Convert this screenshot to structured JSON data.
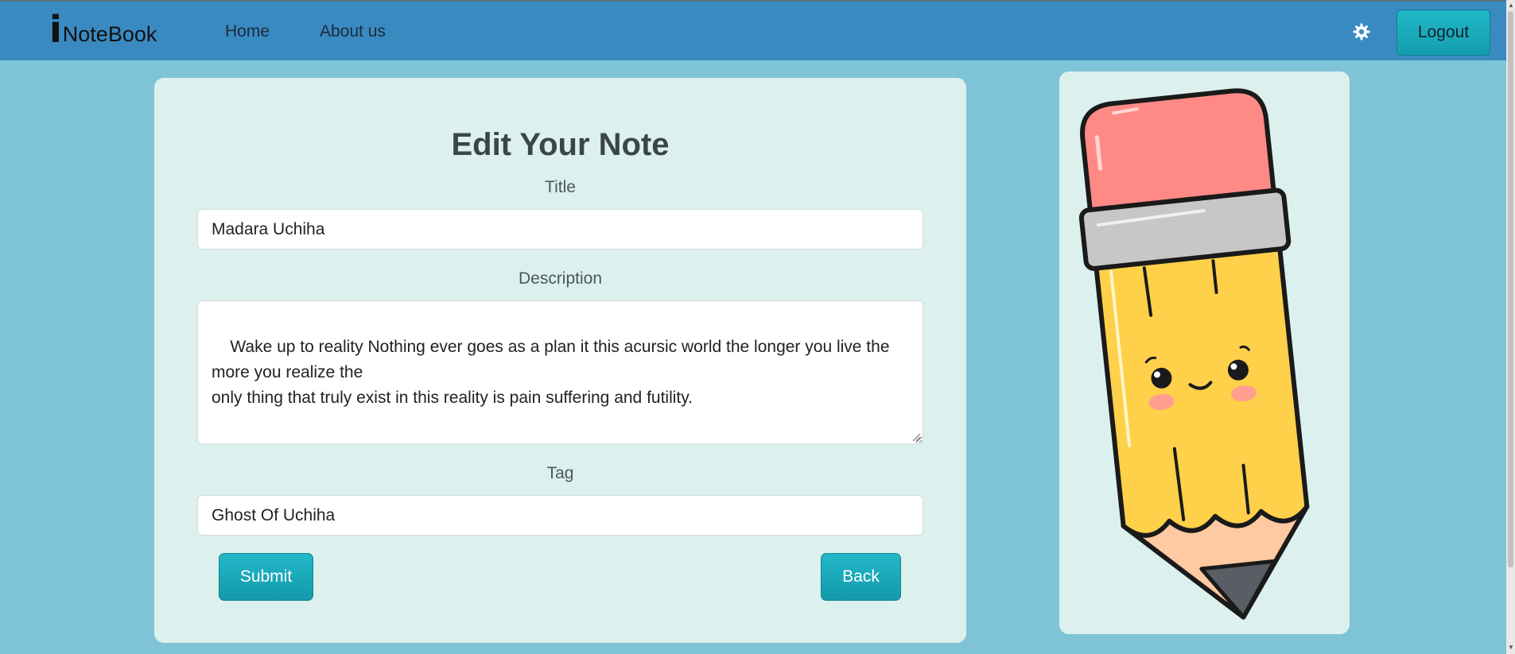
{
  "brand": {
    "initial": "i",
    "name": "NoteBook"
  },
  "nav": {
    "home": "Home",
    "about": "About us",
    "logout": "Logout"
  },
  "form": {
    "heading": "Edit Your Note",
    "title_label": "Title",
    "title_value": "Madara Uchiha",
    "description_label": "Description",
    "description_value": "Wake up to reality Nothing ever goes as a plan it this acursic world the longer you live the more you realize the\nonly thing that truly exist in this reality is pain suffering and futility.",
    "tag_label": "Tag",
    "tag_value": "Ghost Of Uchiha",
    "submit_label": "Submit",
    "back_label": "Back"
  },
  "icons": {
    "theme_toggle": "gear-icon",
    "illustration": "pencil-illustration"
  },
  "colors": {
    "navbar": "#3a8ac2",
    "background": "#7fc4d6",
    "card": "#dcf0ee",
    "button": "#17a8b8"
  }
}
